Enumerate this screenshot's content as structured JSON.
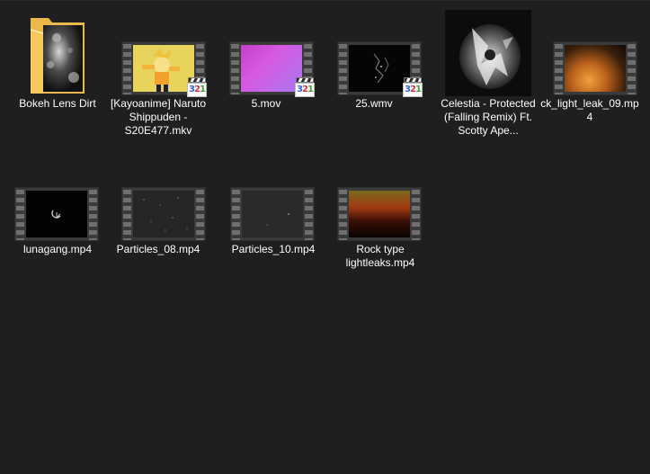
{
  "items": [
    {
      "name": "Bokeh Lens Dirt",
      "type": "folder"
    },
    {
      "name": "[Kayoanime] Naruto Shippuden - S20E477.mkv",
      "type": "video",
      "badge": "321"
    },
    {
      "name": "5.mov",
      "type": "video",
      "badge": "321"
    },
    {
      "name": "25.wmv",
      "type": "video",
      "badge": "321"
    },
    {
      "name": "Celestia - Protected (Falling Remix) Ft. Scotty Ape...",
      "type": "audio-art"
    },
    {
      "name": "ck_light_leak_09.mp4",
      "type": "video"
    },
    {
      "name": "lunagang.mp4",
      "type": "video"
    },
    {
      "name": "Particles_08.mp4",
      "type": "video"
    },
    {
      "name": "Particles_10.mp4",
      "type": "video"
    },
    {
      "name": "Rock type lightleaks.mp4",
      "type": "video"
    }
  ],
  "badge_text": {
    "d3": "3",
    "d2": "2",
    "d1": "1"
  },
  "colors": {
    "background": "#1f1f1f",
    "label": "#ffffff",
    "folder": "#f6c85f",
    "film_frame": "#3a3a3a"
  },
  "icons": [
    "folder-icon",
    "film-strip-icon",
    "mpc-321-badge-icon",
    "album-art-thumbnail"
  ]
}
